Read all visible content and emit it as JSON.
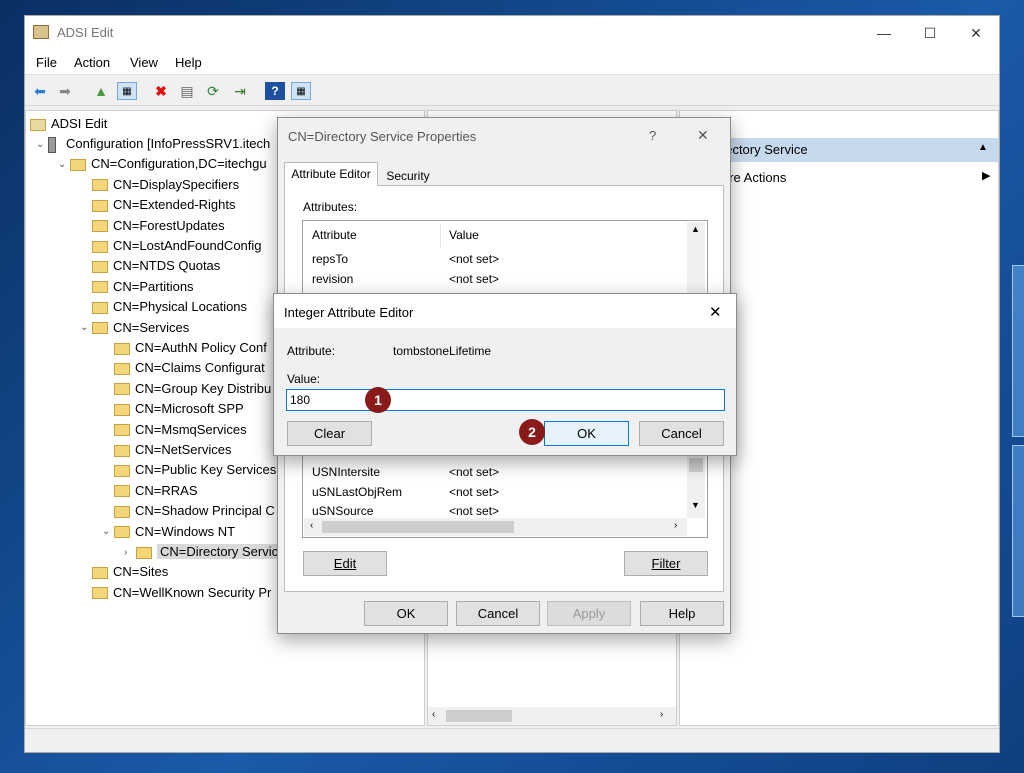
{
  "app": {
    "title": "ADSI Edit"
  },
  "menu": [
    "File",
    "Action",
    "View",
    "Help"
  ],
  "tree": {
    "root": "ADSI Edit",
    "rows": [
      {
        "label": "Configuration [InfoPressSRV1.itech",
        "indent": 1,
        "chev": "⌄",
        "icon": "server"
      },
      {
        "label": "CN=Configuration,DC=itechgu",
        "indent": 2,
        "chev": "⌄",
        "icon": "folder"
      },
      {
        "label": "CN=DisplaySpecifiers",
        "indent": 3,
        "chev": "",
        "icon": "folder"
      },
      {
        "label": "CN=Extended-Rights",
        "indent": 3,
        "chev": "",
        "icon": "folder"
      },
      {
        "label": "CN=ForestUpdates",
        "indent": 3,
        "chev": "",
        "icon": "folder"
      },
      {
        "label": "CN=LostAndFoundConfig",
        "indent": 3,
        "chev": "",
        "icon": "folder"
      },
      {
        "label": "CN=NTDS Quotas",
        "indent": 3,
        "chev": "",
        "icon": "folder"
      },
      {
        "label": "CN=Partitions",
        "indent": 3,
        "chev": "",
        "icon": "folder"
      },
      {
        "label": "CN=Physical Locations",
        "indent": 3,
        "chev": "",
        "icon": "folder"
      },
      {
        "label": "CN=Services",
        "indent": 3,
        "chev": "⌄",
        "icon": "folder"
      },
      {
        "label": "CN=AuthN Policy Conf",
        "indent": 4,
        "chev": "",
        "icon": "folder"
      },
      {
        "label": "CN=Claims Configurat",
        "indent": 4,
        "chev": "",
        "icon": "folder"
      },
      {
        "label": "CN=Group Key Distribu",
        "indent": 4,
        "chev": "",
        "icon": "folder"
      },
      {
        "label": "CN=Microsoft SPP",
        "indent": 4,
        "chev": "",
        "icon": "folder"
      },
      {
        "label": "CN=MsmqServices",
        "indent": 4,
        "chev": "",
        "icon": "folder"
      },
      {
        "label": "CN=NetServices",
        "indent": 4,
        "chev": "",
        "icon": "folder"
      },
      {
        "label": "CN=Public Key Services",
        "indent": 4,
        "chev": "",
        "icon": "folder"
      },
      {
        "label": "CN=RRAS",
        "indent": 4,
        "chev": "",
        "icon": "folder"
      },
      {
        "label": "CN=Shadow Principal C",
        "indent": 4,
        "chev": "",
        "icon": "folder"
      },
      {
        "label": "CN=Windows NT",
        "indent": 4,
        "chev": "⌄",
        "icon": "folder"
      },
      {
        "label": "CN=Directory Servic",
        "indent": 5,
        "chev": "›",
        "icon": "folder",
        "selected": true
      },
      {
        "label": "CN=Sites",
        "indent": 3,
        "chev": "",
        "icon": "folder"
      },
      {
        "label": "CN=WellKnown Security Pr",
        "indent": 3,
        "chev": "",
        "icon": "folder"
      }
    ]
  },
  "actions": {
    "header": "irectory Service",
    "more": "ore Actions"
  },
  "props_dialog": {
    "title": "CN=Directory Service Properties",
    "help": "?",
    "tabs": [
      "Attribute Editor",
      "Security"
    ],
    "attributes_label": "Attributes:",
    "columns": [
      "Attribute",
      "Value"
    ],
    "rows_top": [
      {
        "attr": "repsTo",
        "value": "<not set>"
      },
      {
        "attr": "revision",
        "value": "<not set>"
      }
    ],
    "rows_bottom": [
      {
        "attr": "USNIntersite",
        "value": "<not set>"
      },
      {
        "attr": "uSNLastObjRem",
        "value": "<not set>"
      },
      {
        "attr": "uSNSource",
        "value": "<not set>"
      }
    ],
    "edit_label": "Edit",
    "filter_label": "Filter",
    "ok_label": "OK",
    "cancel_label": "Cancel",
    "apply_label": "Apply",
    "help_label": "Help"
  },
  "int_editor": {
    "title": "Integer Attribute Editor",
    "attribute_label": "Attribute:",
    "attribute_value": "tombstoneLifetime",
    "value_label": "Value:",
    "value": "180",
    "clear_label": "Clear",
    "ok_label": "OK",
    "cancel_label": "Cancel"
  },
  "markers": [
    "1",
    "2"
  ]
}
